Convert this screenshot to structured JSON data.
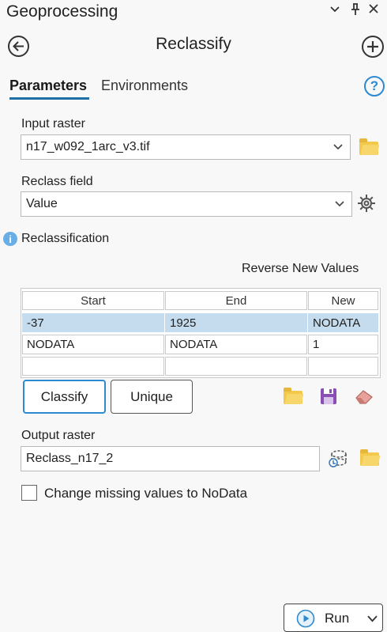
{
  "pane": {
    "title": "Geoprocessing",
    "header_icons": [
      "chevron-down-icon",
      "pin-icon",
      "close-icon"
    ]
  },
  "tool": {
    "title": "Reclassify",
    "back_icon": "arrow-left-circle-icon",
    "add_icon": "plus-circle-icon"
  },
  "tabs": [
    {
      "label": "Parameters",
      "active": true
    },
    {
      "label": "Environments",
      "active": false
    }
  ],
  "help": {
    "glyph": "?"
  },
  "input_raster": {
    "label": "Input raster",
    "value": "n17_w092_1arc_v3.tif"
  },
  "reclass_field": {
    "label": "Reclass field",
    "value": "Value"
  },
  "reclassification": {
    "label": "Reclassification",
    "info_glyph": "i",
    "reverse_label": "Reverse New Values",
    "columns": [
      "Start",
      "End",
      "New"
    ],
    "rows": [
      {
        "start": "-37",
        "end": "1925",
        "new": "NODATA",
        "selected": true
      },
      {
        "start": "NODATA",
        "end": "NODATA",
        "new": "1",
        "selected": false
      },
      {
        "start": "",
        "end": "",
        "new": "",
        "selected": false
      }
    ],
    "buttons": {
      "classify": "Classify",
      "unique": "Unique"
    }
  },
  "output_raster": {
    "label": "Output raster",
    "value": "Reclass_n17_2"
  },
  "missing_values": {
    "label": "Change missing values to NoData",
    "checked": false
  },
  "run": {
    "label": "Run"
  },
  "colors": {
    "accent": "#2b8ad0",
    "tab_underline": "#1d6fa5",
    "selected_row": "#c5dcee",
    "folder": "#f3c94c",
    "save": "#8a4fb5"
  }
}
